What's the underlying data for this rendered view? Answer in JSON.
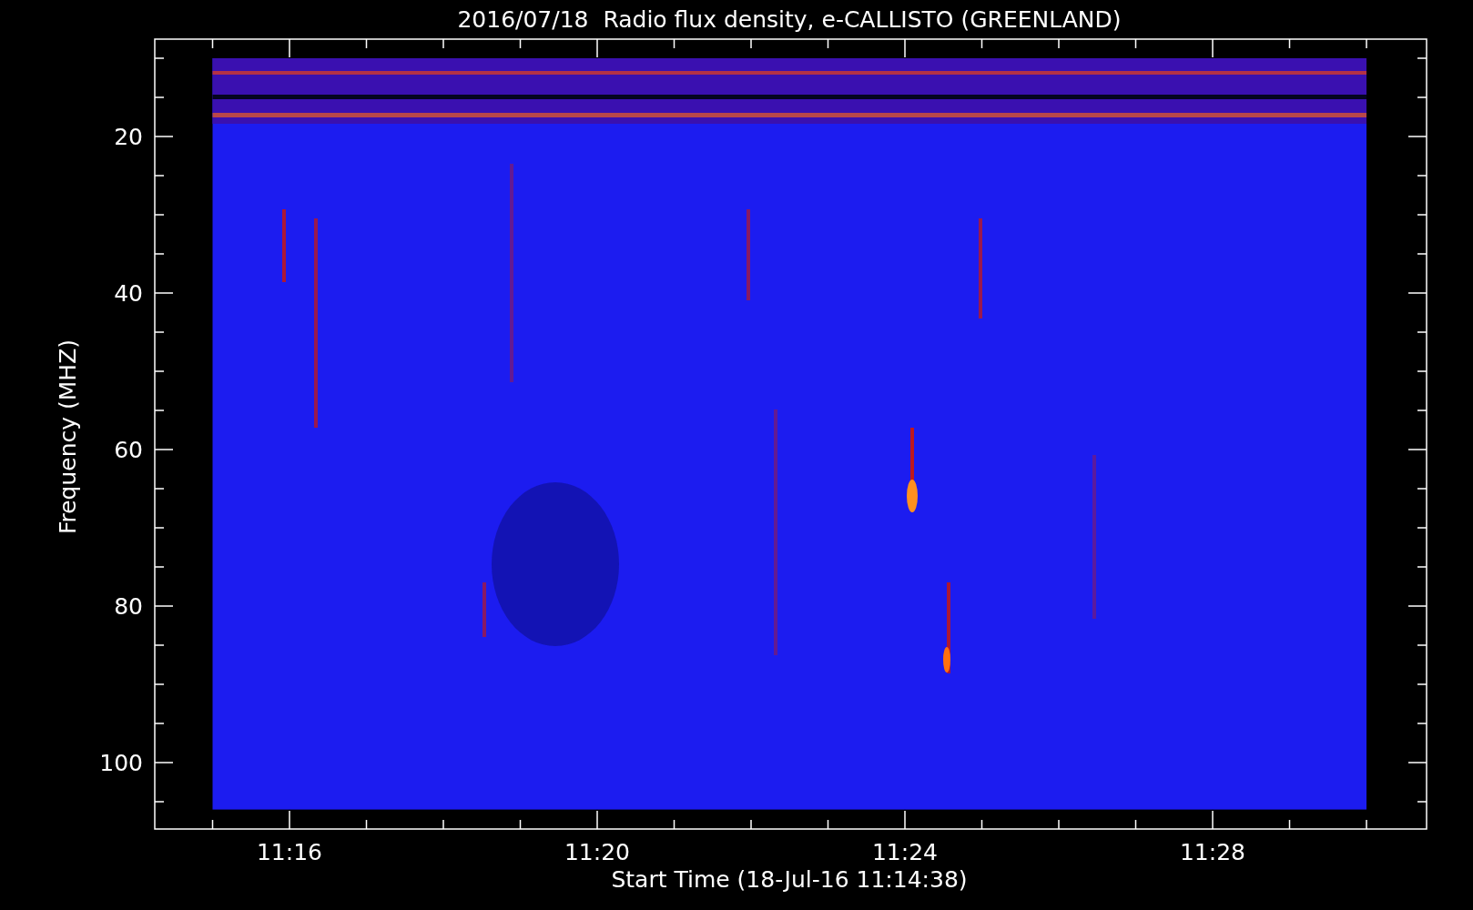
{
  "title": "2016/07/18  Radio flux density, e-CALLISTO (GREENLAND)",
  "y_axis": {
    "label": "Frequency (MHZ)",
    "ticks": [
      "20",
      "40",
      "60",
      "80",
      "100"
    ]
  },
  "x_axis": {
    "label": "Start Time (18-Jul-16 11:14:38)",
    "ticks": [
      "11:16",
      "11:20",
      "11:24",
      "11:28"
    ]
  }
}
